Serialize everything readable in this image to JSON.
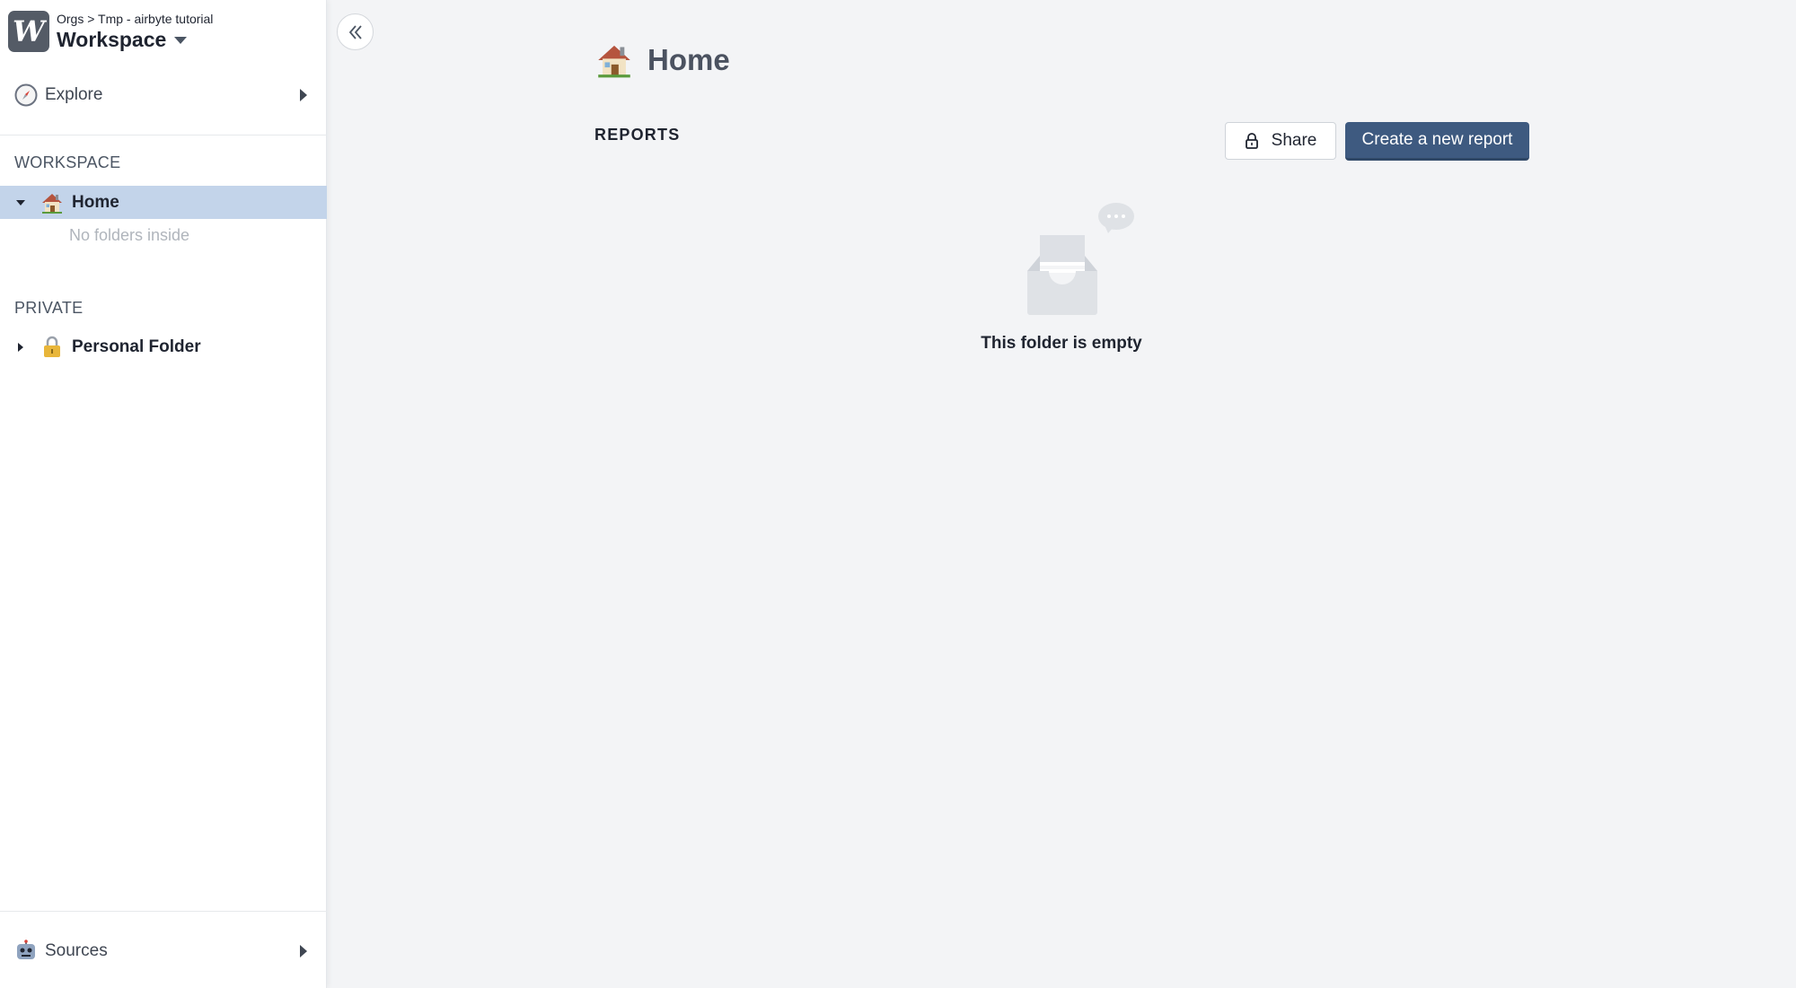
{
  "workspace": {
    "breadcrumb": "Orgs > Tmp - airbyte tutorial",
    "name": "Workspace"
  },
  "sidebar": {
    "explore_label": "Explore",
    "workspace_heading": "WORKSPACE",
    "home_label": "Home",
    "home_empty_note": "No folders inside",
    "private_heading": "PRIVATE",
    "personal_folder_label": "Personal Folder",
    "sources_label": "Sources"
  },
  "main": {
    "title": "Home",
    "reports_heading": "REPORTS",
    "share_label": "Share",
    "create_label": "Create a new report",
    "empty_text": "This folder is empty"
  },
  "colors": {
    "accent": "#3e5a80",
    "selected_row": "#c3d4ea",
    "background": "#f3f4f6"
  },
  "icons": [
    "logo-icon",
    "compass-icon",
    "house-icon",
    "lock-icon",
    "robot-icon",
    "double-chevron-left-icon",
    "empty-inbox-icon"
  ]
}
